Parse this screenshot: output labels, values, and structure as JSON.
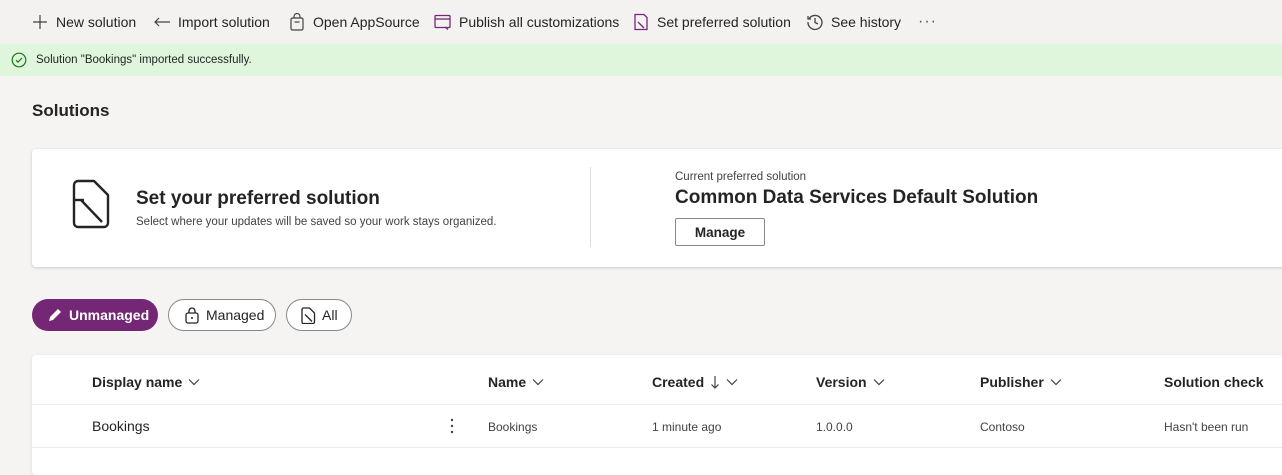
{
  "commandbar": {
    "items": [
      {
        "label": "New solution",
        "icon": "add-icon"
      },
      {
        "label": "Import solution",
        "icon": "import-arrow-icon"
      },
      {
        "label": "Open AppSource",
        "icon": "shopping-bag-icon"
      },
      {
        "label": "Publish all customizations",
        "icon": "publish-icon"
      },
      {
        "label": "Set preferred solution",
        "icon": "document-preferred-icon"
      },
      {
        "label": "See history",
        "icon": "history-icon"
      }
    ],
    "more": "···"
  },
  "message": {
    "text": "Solution \"Bookings\" imported successfully.",
    "icon": "success-check-icon"
  },
  "page": {
    "title": "Solutions"
  },
  "preferred": {
    "heading": "Set your preferred solution",
    "subtext": "Select where your updates will be saved so your work stays organized.",
    "current_label": "Current preferred solution",
    "current_name": "Common Data Services Default Solution",
    "manage_label": "Manage"
  },
  "filters": [
    {
      "label": "Unmanaged",
      "selected": true,
      "icon": "pencil-icon"
    },
    {
      "label": "Managed",
      "selected": false,
      "icon": "lock-icon"
    },
    {
      "label": "All",
      "selected": false,
      "icon": "solution-icon"
    }
  ],
  "grid": {
    "columns": [
      {
        "label": "Display name",
        "sorted": false
      },
      {
        "label": "Name",
        "sorted": false
      },
      {
        "label": "Created",
        "sorted": true
      },
      {
        "label": "Version",
        "sorted": false
      },
      {
        "label": "Publisher",
        "sorted": false
      },
      {
        "label": "Solution check",
        "sorted": false
      }
    ],
    "rows": [
      {
        "display_name": "Bookings",
        "name": "Bookings",
        "created": "1 minute ago",
        "version": "1.0.0.0",
        "publisher": "Contoso",
        "solution_check": "Hasn't been run"
      }
    ]
  },
  "colors": {
    "accent": "#742774",
    "success_bg": "#dff6dd",
    "success_icon": "#107c10"
  }
}
